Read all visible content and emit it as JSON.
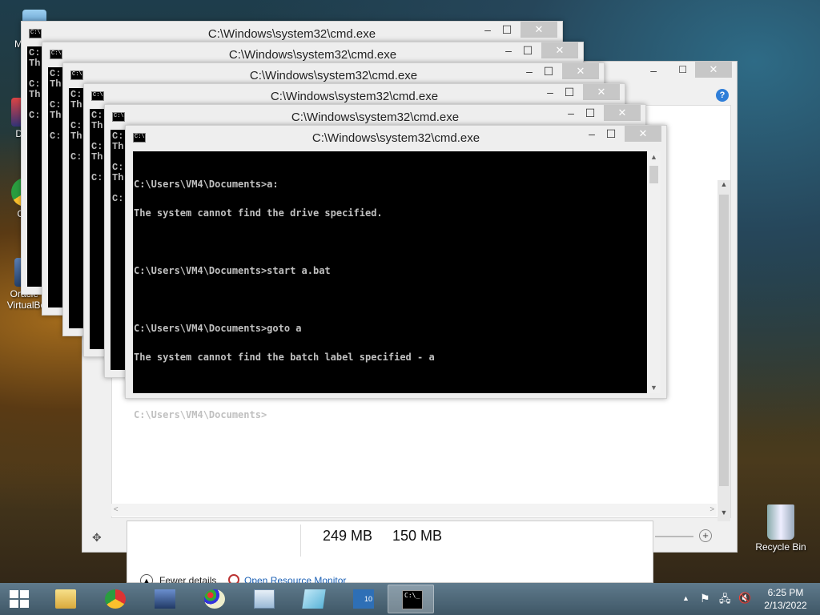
{
  "desktop": {
    "icons": [
      {
        "label": "My C"
      },
      {
        "label": "Data"
      },
      {
        "label": "G C"
      },
      {
        "label": "Oracle V VirtualBox"
      },
      {
        "label": "Recycle Bin"
      }
    ]
  },
  "task_manager": {
    "memory_a": "249 MB",
    "memory_b": "150 MB",
    "fewer_details": "Fewer details",
    "open_resource_monitor": "Open Resource Monitor"
  },
  "cmd_windows": [
    {
      "title": "C:\\Windows\\system32\\cmd.exe"
    },
    {
      "title": "C:\\Windows\\system32\\cmd.exe"
    },
    {
      "title": "C:\\Windows\\system32\\cmd.exe"
    },
    {
      "title": "C:\\Windows\\system32\\cmd.exe"
    },
    {
      "title": "C:\\Windows\\system32\\cmd.exe"
    },
    {
      "title": "C:\\Windows\\system32\\cmd.exe"
    }
  ],
  "front_cmd": {
    "lines": [
      "C:\\Users\\VM4\\Documents>a:",
      "The system cannot find the drive specified.",
      "",
      "C:\\Users\\VM4\\Documents>start a.bat",
      "",
      "C:\\Users\\VM4\\Documents>goto a",
      "The system cannot find the batch label specified - a",
      "",
      "C:\\Users\\VM4\\Documents>"
    ]
  },
  "stub_text": "C:\nTh\n\nC:\nTh\n\nC:",
  "taskbar": {
    "items": [
      {
        "name": "start"
      },
      {
        "name": "file-explorer"
      },
      {
        "name": "chrome"
      },
      {
        "name": "virtualbox"
      },
      {
        "name": "paint"
      },
      {
        "name": "task-manager"
      },
      {
        "name": "notepad"
      },
      {
        "name": "windows-10-setup"
      },
      {
        "name": "command-prompt"
      }
    ],
    "clock_time": "6:25 PM",
    "clock_date": "2/13/2022"
  }
}
